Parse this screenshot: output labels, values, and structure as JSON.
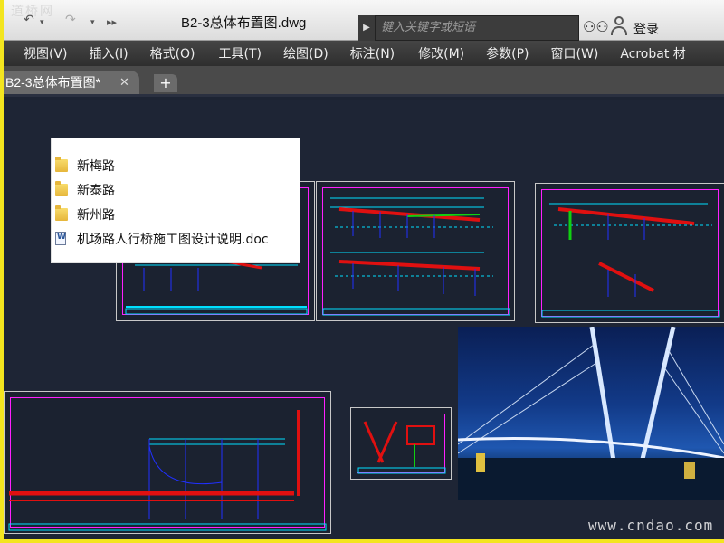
{
  "titlebar": {
    "title": "B2-3总体布置图.dwg",
    "search_placeholder": "键入关键字或短语",
    "login_label": "登录",
    "watermark_tl": "道桥网"
  },
  "menu": {
    "items": [
      "视图(V)",
      "插入(I)",
      "格式(O)",
      "工具(T)",
      "绘图(D)",
      "标注(N)",
      "修改(M)",
      "参数(P)",
      "窗口(W)",
      "Acrobat 材"
    ]
  },
  "tabs": {
    "active_label": "B2-3总体布置图*",
    "close_symbol": "✕",
    "add_symbol": "+"
  },
  "file_list": {
    "items": [
      {
        "type": "folder",
        "label": "新梅路"
      },
      {
        "type": "folder",
        "label": "新泰路"
      },
      {
        "type": "folder",
        "label": "新州路"
      },
      {
        "type": "doc",
        "label": "机场路人行桥施工图设计说明.doc"
      }
    ]
  },
  "watermark": "www.cndao.com",
  "colors": {
    "canvas": "#1e2535",
    "sheet_border": "#ff20ff",
    "drawing_red": "#e01010",
    "drawing_cyan": "#00e0ff",
    "drawing_blue": "#2030ff",
    "drawing_green": "#10d010"
  },
  "icons": {
    "undo": "undo-icon",
    "redo": "redo-icon",
    "search": "binoculars-icon",
    "user": "user-icon"
  }
}
